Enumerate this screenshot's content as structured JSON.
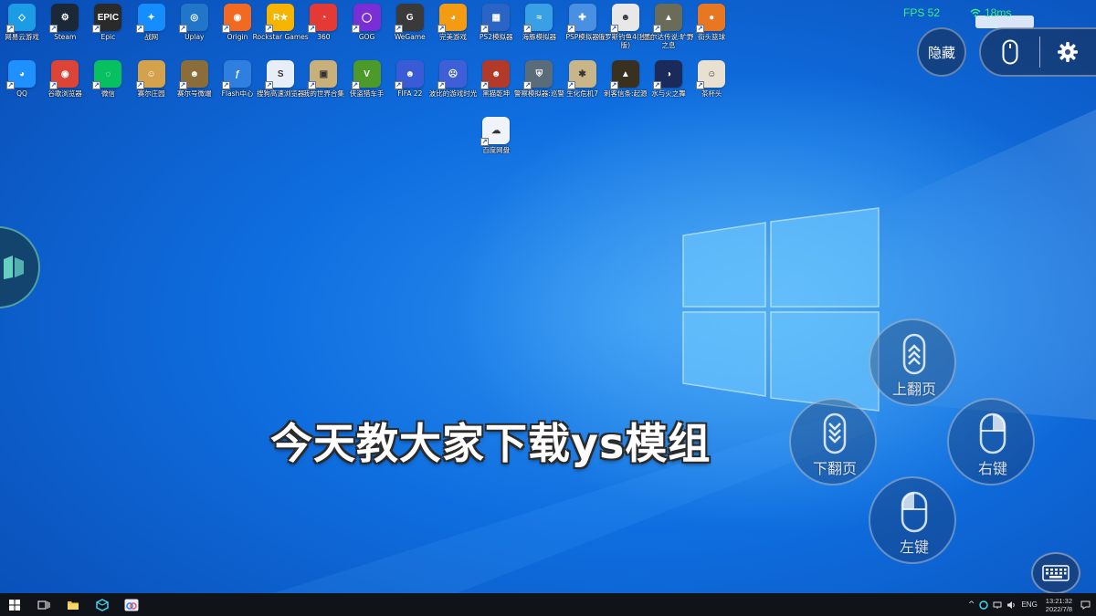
{
  "desktop_icons_row1": [
    {
      "label": "网易云游戏",
      "color": "#1c9be6",
      "glyph": "◇",
      "icon": "cloud-game-icon"
    },
    {
      "label": "Steam",
      "color": "#1b2838",
      "glyph": "⚙",
      "icon": "steam-icon"
    },
    {
      "label": "Epic",
      "color": "#2a2a2a",
      "glyph": "EPIC",
      "icon": "epic-icon"
    },
    {
      "label": "战网",
      "color": "#148eff",
      "glyph": "✦",
      "icon": "battlenet-icon"
    },
    {
      "label": "Uplay",
      "color": "#2176c9",
      "glyph": "◎",
      "icon": "uplay-icon"
    },
    {
      "label": "Origin",
      "color": "#f26a21",
      "glyph": "◉",
      "icon": "origin-icon"
    },
    {
      "label": "Rockstar Games",
      "color": "#f4b400",
      "glyph": "R★",
      "icon": "rockstar-icon"
    },
    {
      "label": "360",
      "color": "#e53935",
      "glyph": "◔",
      "icon": "360-icon"
    },
    {
      "label": "GOG",
      "color": "#7a2fd6",
      "glyph": "◯",
      "icon": "gog-icon"
    },
    {
      "label": "WeGame",
      "color": "#3a3a3a",
      "glyph": "G",
      "icon": "wegame-icon"
    },
    {
      "label": "完美游戏",
      "color": "#f39c12",
      "glyph": "◕",
      "icon": "perfect-world-icon"
    },
    {
      "label": "PS2模拟器",
      "color": "#2a64c5",
      "glyph": "▦",
      "icon": "ps2-emulator-icon"
    },
    {
      "label": "海豚模拟器",
      "color": "#3aa0e6",
      "glyph": "≈",
      "icon": "dolphin-emulator-icon"
    },
    {
      "label": "PSP模拟器",
      "color": "#4a90e2",
      "glyph": "✚",
      "icon": "psp-emulator-icon"
    },
    {
      "label": "俄罗斯钓鱼4(独立版)",
      "color": "#e8e8e8",
      "glyph": "☻",
      "icon": "fishing-icon"
    },
    {
      "label": "墨尔达传说:旷野之息",
      "color": "#6b6b5a",
      "glyph": "▲",
      "icon": "zelda-icon"
    },
    {
      "label": "街头篮球",
      "color": "#e87722",
      "glyph": "●",
      "icon": "basketball-icon"
    }
  ],
  "desktop_icons_row2": [
    {
      "label": "QQ",
      "color": "#1e90ff",
      "glyph": "◕",
      "icon": "qq-icon"
    },
    {
      "label": "谷歌浏览器",
      "color": "#db4437",
      "glyph": "◉",
      "icon": "chrome-icon"
    },
    {
      "label": "微信",
      "color": "#07c160",
      "glyph": "◌",
      "icon": "wechat-icon"
    },
    {
      "label": "赛尔庄园",
      "color": "#d4a24c",
      "glyph": "☺",
      "icon": "seer-manor-icon"
    },
    {
      "label": "赛尔号微端",
      "color": "#8a6d3b",
      "glyph": "☻",
      "icon": "seer-icon"
    },
    {
      "label": "Flash中心",
      "color": "#2f7fe0",
      "glyph": "ƒ",
      "icon": "flash-icon"
    },
    {
      "label": "搜狗高速浏览器",
      "color": "#e8eef8",
      "glyph": "S",
      "icon": "sogou-browser-icon"
    },
    {
      "label": "我的世界合集",
      "color": "#c8b07a",
      "glyph": "▣",
      "icon": "minecraft-icon"
    },
    {
      "label": "侠盗猎车手",
      "color": "#4c9a2a",
      "glyph": "V",
      "icon": "gta-icon"
    },
    {
      "label": "FIFA 22",
      "color": "#3a5bd6",
      "glyph": "☻",
      "icon": "fifa-icon"
    },
    {
      "label": "波比的游戏时光",
      "color": "#3f5fd6",
      "glyph": "☹",
      "icon": "poppy-playtime-icon"
    },
    {
      "label": "黑猫乾坤",
      "color": "#b23a2a",
      "glyph": "☻",
      "icon": "black-cat-icon"
    },
    {
      "label": "警察模拟器:巡警",
      "color": "#5a6b7a",
      "glyph": "⛨",
      "icon": "police-sim-icon"
    },
    {
      "label": "生化危机7",
      "color": "#c8b58a",
      "glyph": "✱",
      "icon": "resident-evil-icon"
    },
    {
      "label": "刺客信条:起源",
      "color": "#3a3020",
      "glyph": "▲",
      "icon": "assassins-creed-icon"
    },
    {
      "label": "水与火之舞",
      "color": "#1a2a5a",
      "glyph": "◑",
      "icon": "fire-ice-icon"
    },
    {
      "label": "茶杯头",
      "color": "#e8e0d0",
      "glyph": "☺",
      "icon": "cuphead-icon"
    }
  ],
  "desktop_icons_row3": [
    {
      "label": "百度网盘",
      "color": "#f0f4fa",
      "glyph": "☁",
      "icon": "baidu-netdisk-icon"
    }
  ],
  "hud": {
    "fps": "FPS 52",
    "ping": "18ms",
    "hide_label": "隐藏"
  },
  "controls": {
    "page_up": "上翻页",
    "page_down": "下翻页",
    "right_click": "右键",
    "left_click": "左键"
  },
  "subtitle": "今天教大家下载ys模组",
  "taskbar": {
    "tray_expand": "^",
    "language": "ENG",
    "time": "13:21:32",
    "date": "2022/7/8"
  }
}
